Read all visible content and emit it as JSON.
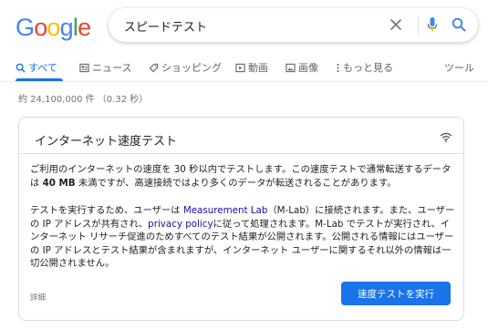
{
  "logo": {
    "text": "Google",
    "letters": [
      "G",
      "o",
      "o",
      "g",
      "l",
      "e"
    ],
    "colors": [
      "#4285f4",
      "#ea4335",
      "#fbbc05",
      "#4285f4",
      "#34a853",
      "#ea4335"
    ]
  },
  "search": {
    "query": "スピードテスト",
    "icons": [
      "close-icon",
      "mic-icon",
      "search-icon"
    ]
  },
  "tabs": [
    {
      "label": "すべて",
      "icon": "search-icon",
      "active": true
    },
    {
      "label": "ニュース",
      "icon": "news-icon",
      "active": false
    },
    {
      "label": "ショッピング",
      "icon": "tag-icon",
      "active": false
    },
    {
      "label": "動画",
      "icon": "play-icon",
      "active": false
    },
    {
      "label": "画像",
      "icon": "image-icon",
      "active": false
    },
    {
      "label": "もっと見る",
      "icon": "more-icon",
      "active": false
    }
  ],
  "tools_label": "ツール",
  "result_stats": "約 24,100,000 件 （0.32 秒）",
  "card": {
    "title": "インターネット速度テスト",
    "para1_a": "ご利用のインターネットの速度を 30 秒以内でテストします。この速度テストで通常転送するデータは ",
    "para1_bold": "40 MB",
    "para1_b": " 未満ですが、高速接続ではより多くのデータが転送されることがあります。",
    "para2_a": "テストを実行するため、ユーザーは ",
    "para2_link1": "Measurement Lab",
    "para2_b": "（M-Lab）に接続されます。また、ユーザーの IP アドレスが共有され、",
    "para2_link2": "privacy policy",
    "para2_c": "に従って処理されます。M-Lab でテストが実行され、インターネット リサーチ促進のためすべてのテスト結果が公開されます。公開される情報にはユーザーの IP アドレスとテスト結果が含まれますが、インターネット ユーザーに関するそれ以外の情報は一切公開されません。",
    "details_label": "詳細",
    "button_label": "速度テストを実行"
  },
  "colors": {
    "accent": "#1a73e8",
    "link": "#1a0dab",
    "muted": "#70757a"
  }
}
